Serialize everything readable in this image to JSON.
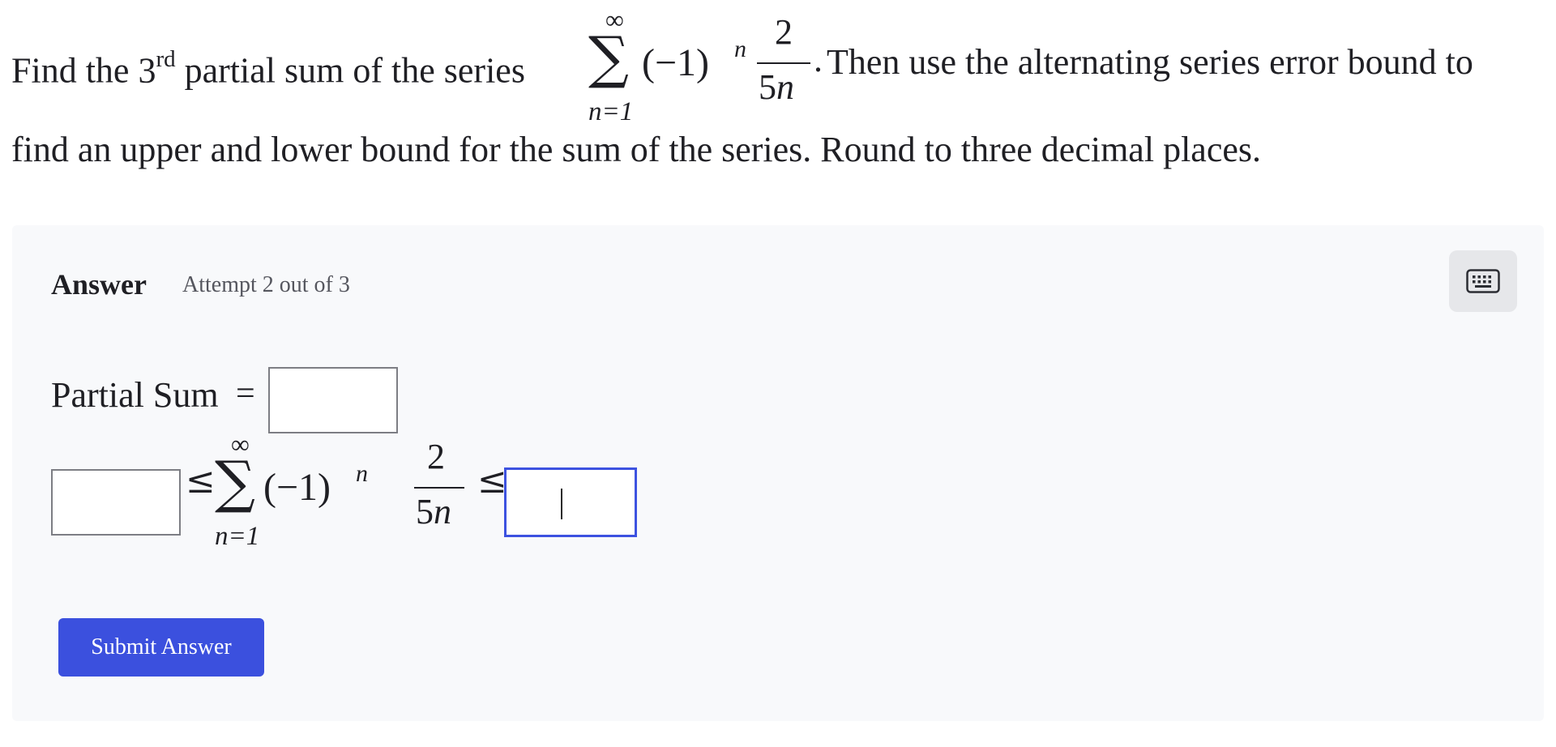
{
  "question": {
    "line1_prefix": "Find the 3",
    "line1_sup": "rd",
    "line1_middle": " partial sum of the series",
    "line1_suffix": "Then use the alternating series error bound to",
    "line2": "find an upper and lower bound for the sum of the series. Round to three decimal places.",
    "series": {
      "upper_limit": "∞",
      "lower_limit": "n=1",
      "term": "(−1)",
      "exponent": "n",
      "numerator": "2",
      "denominator_coef": "5",
      "denominator_var": "n",
      "period": "."
    }
  },
  "answer": {
    "heading": "Answer",
    "attempt": "Attempt 2 out of 3",
    "partial_sum_label": "Partial Sum",
    "equals": "=",
    "leq": "≤",
    "inputs": {
      "partial_sum_value": "",
      "lower_bound_value": "",
      "upper_bound_value": ""
    },
    "submit_label": "Submit Answer"
  },
  "icons": {
    "keyboard": "keyboard-icon"
  },
  "colors": {
    "accent": "#3b50de",
    "panel_bg": "#f8f9fb",
    "focus_border": "#3d52e0"
  }
}
